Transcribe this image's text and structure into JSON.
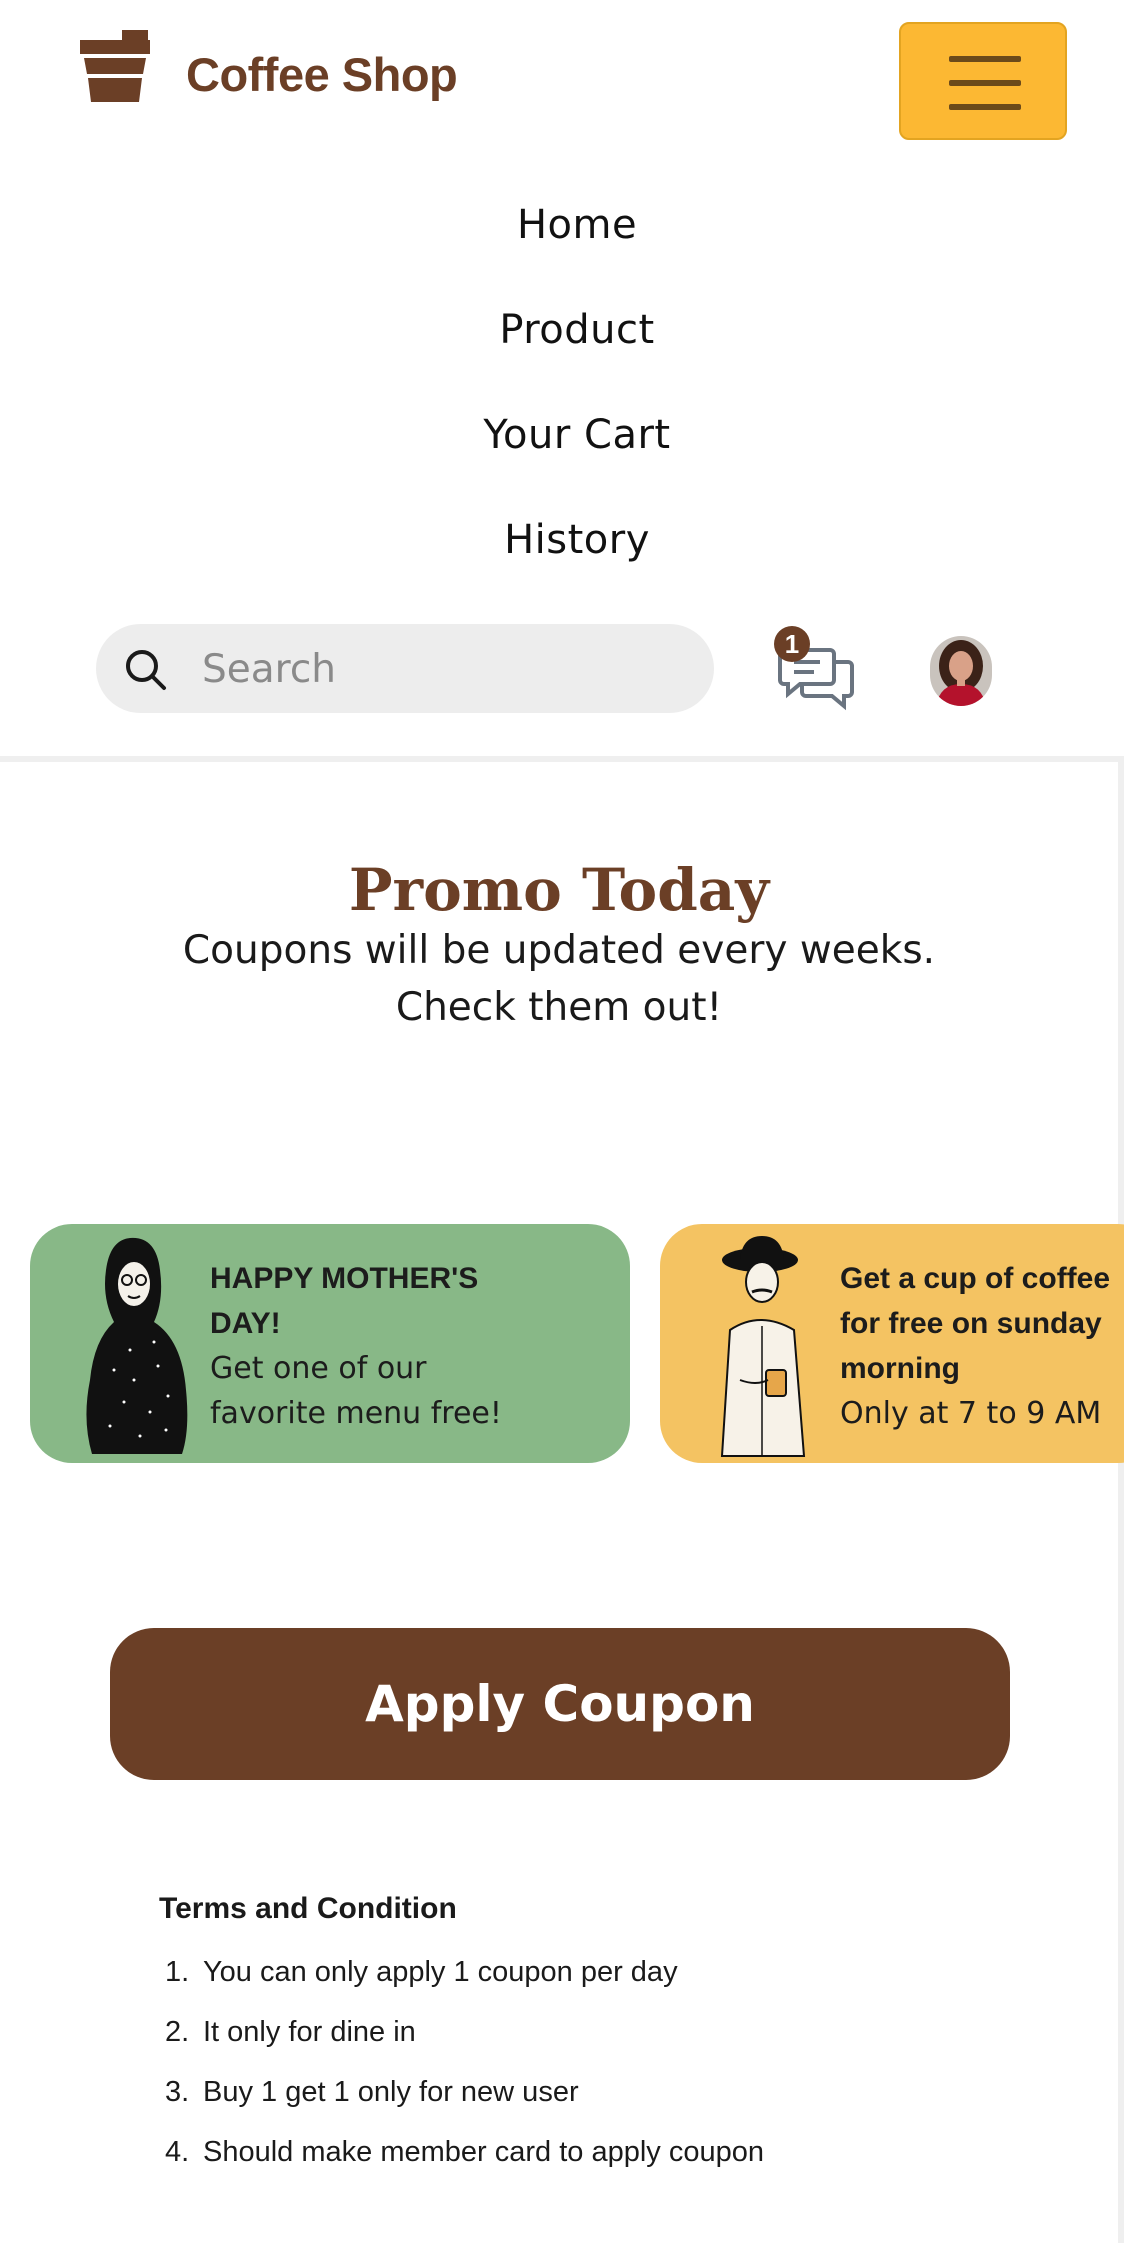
{
  "header": {
    "brand": "Coffee Shop",
    "logo_icon": "coffee-cup-icon",
    "menu_icon": "hamburger-icon"
  },
  "nav": {
    "items": [
      "Home",
      "Product",
      "Your Cart",
      "History"
    ]
  },
  "search": {
    "placeholder": "Search",
    "value": ""
  },
  "chat": {
    "badge_count": "1",
    "icon": "chat-icon"
  },
  "promo": {
    "title": "Promo Today",
    "subtitle_line1": "Coupons will be updated every weeks.",
    "subtitle_line2": "Check them out!"
  },
  "coupons": [
    {
      "title_line1": "HAPPY MOTHER'S",
      "title_line2": "DAY!",
      "desc_line1": "Get one of our",
      "desc_line2": "favorite menu free!",
      "color": "#88b887"
    },
    {
      "title_line1": "Get a cup of coffee",
      "title_line2": "for free on sunday",
      "title_line3": "morning",
      "desc_line1": "Only at 7 to 9 AM",
      "color": "#f4c362"
    }
  ],
  "apply_label": "Apply Coupon",
  "terms": {
    "title": "Terms and Condition",
    "items": [
      "You can only apply 1 coupon per day",
      "It only for dine in",
      "Buy 1 get 1 only for new user",
      "Should make member card to apply coupon"
    ],
    "numbers": [
      "1.",
      "2.",
      "3.",
      "4."
    ]
  },
  "colors": {
    "brand_brown": "#6b3f26",
    "menu_yellow": "#fcb833",
    "card_green": "#88b887",
    "card_yellow": "#f4c362"
  }
}
